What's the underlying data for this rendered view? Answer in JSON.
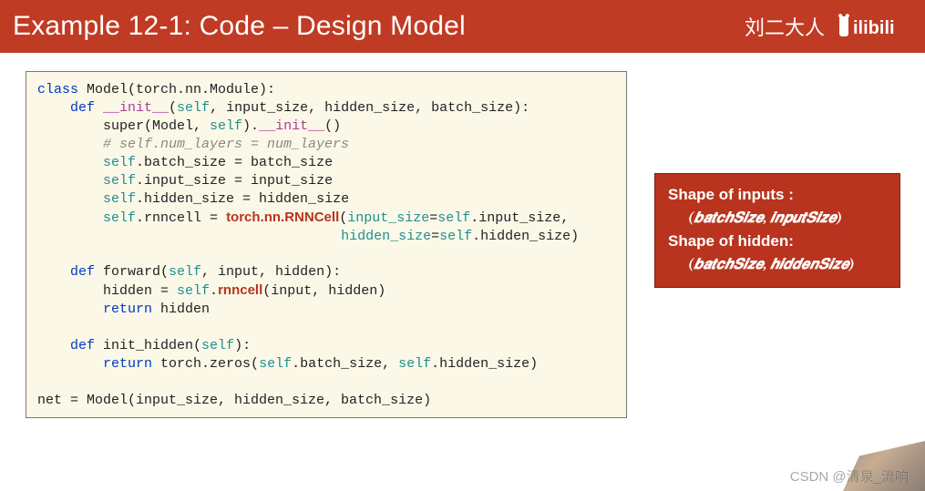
{
  "header": {
    "title": "Example 12-1: Code – Design Model",
    "author": "刘二大人",
    "logo": "bilibili"
  },
  "code": {
    "l1a": "class",
    "l1b": " Model(torch.nn.Module):",
    "l2a": "    def ",
    "l2b": "__init__",
    "l2c": "(",
    "l2d": "self",
    "l2e": ", input_size, hidden_size, batch_size):",
    "l3a": "        super(Model, ",
    "l3b": "self",
    "l3c": ").",
    "l3d": "__init__",
    "l3e": "()",
    "l4": "        # self.num_layers = num_layers",
    "l5a": "        ",
    "l5b": "self",
    "l5c": ".batch_size = batch_size",
    "l6a": "        ",
    "l6b": "self",
    "l6c": ".input_size = input_size",
    "l7a": "        ",
    "l7b": "self",
    "l7c": ".hidden_size = hidden_size",
    "l8a": "        ",
    "l8b": "self",
    "l8c": ".rnncell = ",
    "l8d": "torch.nn.RNNCell",
    "l8e": "(",
    "l8f": "input_size",
    "l8g": "=",
    "l8h": "self",
    "l8i": ".input_size,",
    "l9a": "                                     ",
    "l9b": "hidden_size",
    "l9c": "=",
    "l9d": "self",
    "l9e": ".hidden_size)",
    "l10": "",
    "l11a": "    def",
    "l11b": " forward(",
    "l11c": "self",
    "l11d": ", input, hidden):",
    "l12a": "        hidden = ",
    "l12b": "self",
    "l12c": ".",
    "l12d": "rnncell",
    "l12e": "(input, hidden)",
    "l13a": "        return",
    "l13b": " hidden",
    "l14": "",
    "l15a": "    def",
    "l15b": " init_hidden(",
    "l15c": "self",
    "l15d": "):",
    "l16a": "        return",
    "l16b": " torch.zeros(",
    "l16c": "self",
    "l16d": ".batch_size, ",
    "l16e": "self",
    "l16f": ".hidden_size)",
    "l17": "",
    "l18": "net = Model(input_size, hidden_size, batch_size)"
  },
  "info": {
    "h1": "Shape of inputs :",
    "t1": "(𝒃𝒂𝒕𝒄𝒉𝑺𝒊𝒛𝒆, 𝒊𝒏𝒑𝒖𝒕𝑺𝒊𝒛𝒆)",
    "h2": "Shape of hidden:",
    "t2": "(𝒃𝒂𝒕𝒄𝒉𝑺𝒊𝒛𝒆, 𝒉𝒊𝒅𝒅𝒆𝒏𝑺𝒊𝒛𝒆)"
  },
  "watermark": "CSDN @清泉_流响"
}
